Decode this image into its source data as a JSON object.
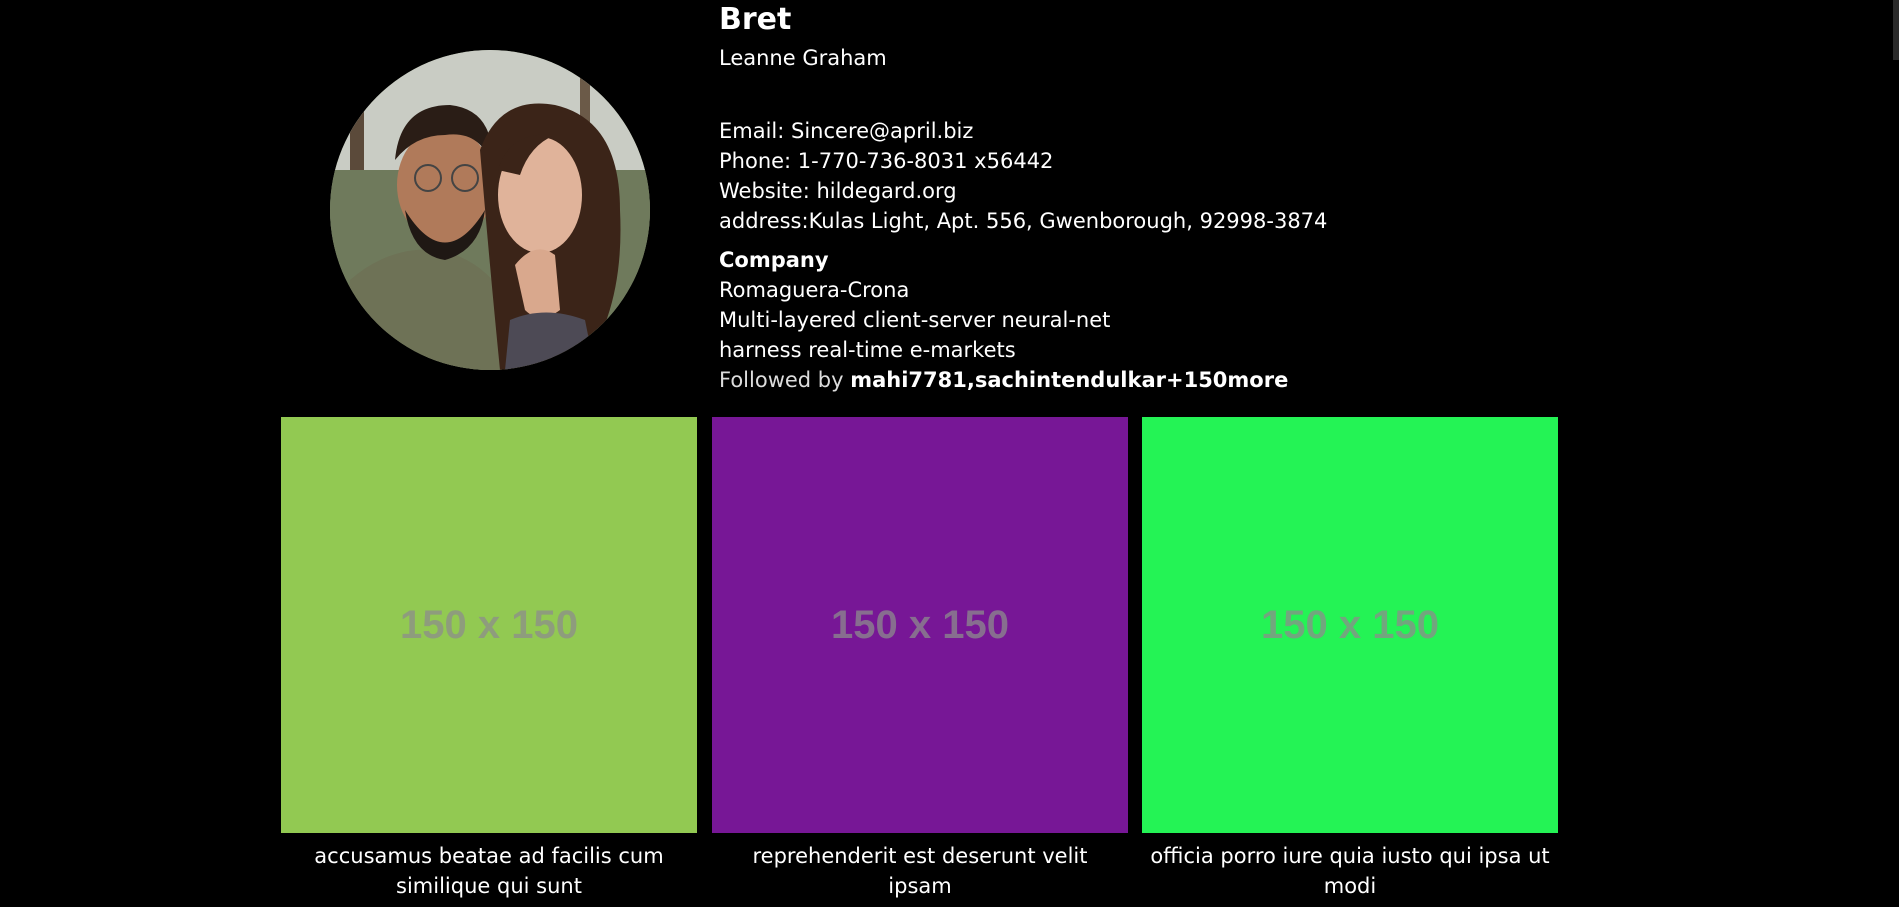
{
  "profile": {
    "username": "Bret",
    "name": "Leanne Graham",
    "email": "Email: Sincere@april.biz",
    "phone": "Phone: 1-770-736-8031 x56442",
    "website": "Website: hildegard.org",
    "address": "address:Kulas Light, Apt. 556, Gwenborough, 92998-3874",
    "company_heading": "Company",
    "company_name": "Romaguera-Crona",
    "company_catchphrase": "Multi-layered client-server neural-net",
    "company_bs": "harness real-time e-markets",
    "followed_prefix": "Followed by ",
    "followed_names": "mahi7781,sachintendulkar+150more"
  },
  "photos": [
    {
      "placeholder": "150 x 150",
      "color": "#92c952",
      "caption": "accusamus beatae ad facilis cum similique qui sunt"
    },
    {
      "placeholder": "150 x 150",
      "color": "#771796",
      "caption": "reprehenderit est deserunt velit ipsam"
    },
    {
      "placeholder": "150 x 150",
      "color": "#24f355",
      "caption": "officia porro iure quia iusto qui ipsa ut modi"
    }
  ]
}
